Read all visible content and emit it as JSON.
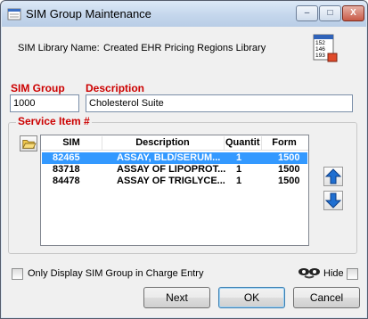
{
  "window": {
    "title": "SIM Group Maintenance",
    "controls": {
      "minimize": "–",
      "maximize": "□",
      "close": "X"
    }
  },
  "library": {
    "label": "SIM Library Name:",
    "value": "Created EHR Pricing Regions Library"
  },
  "calc_icon": {
    "lines": [
      "152",
      "146",
      "193"
    ]
  },
  "fields": {
    "sim_group_label": "SIM Group",
    "sim_group_value": "1000",
    "description_label": "Description",
    "description_value": "Cholesterol Suite"
  },
  "service_items": {
    "label": "Service Item #",
    "columns": [
      "SIM",
      "Description",
      "Quantit",
      "Form"
    ],
    "rows": [
      {
        "sim": "82465",
        "description": "ASSAY, BLD/SERUM...",
        "quantity": "1",
        "form": "1500",
        "selected": true
      },
      {
        "sim": "83718",
        "description": "ASSAY OF LIPOPROT...",
        "quantity": "1",
        "form": "1500",
        "selected": false
      },
      {
        "sim": "84478",
        "description": "ASSAY OF TRIGLYCE...",
        "quantity": "1",
        "form": "1500",
        "selected": false
      }
    ]
  },
  "options": {
    "only_display_label": "Only Display SIM Group in Charge Entry",
    "hide_label": "Hide"
  },
  "buttons": {
    "next": "Next",
    "ok": "OK",
    "cancel": "Cancel"
  },
  "colors": {
    "required_label": "#cc0000",
    "selection": "#3399ff",
    "arrow_blue": "#1f6fd1"
  }
}
